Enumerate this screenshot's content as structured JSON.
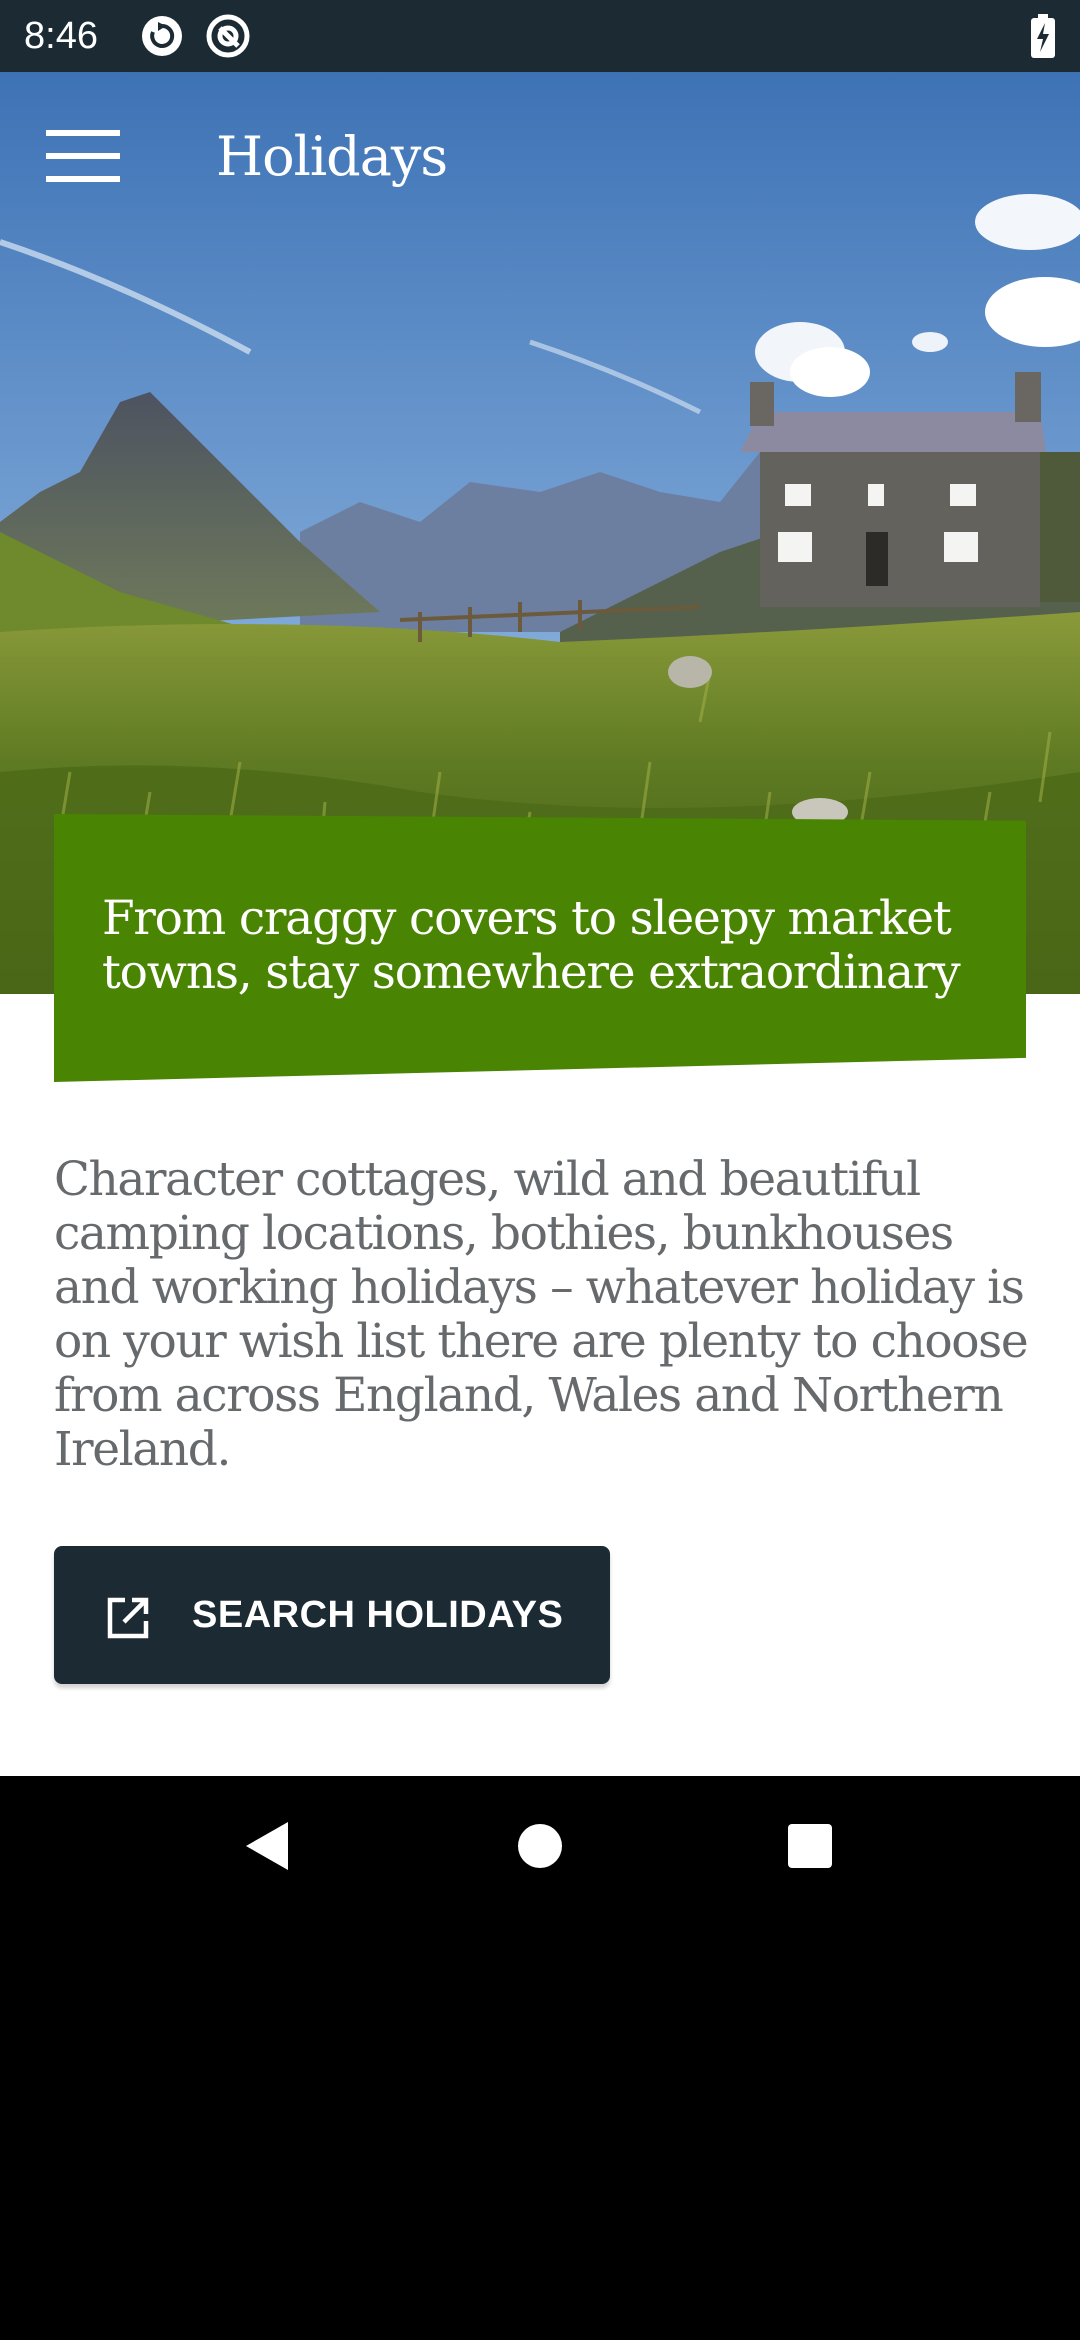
{
  "status_bar": {
    "time": "8:46",
    "icons": [
      "sync-icon",
      "at-sign-icon",
      "battery-charging-icon"
    ]
  },
  "app_bar": {
    "title": "Holidays",
    "menu_icon": "hamburger-menu-icon"
  },
  "hero": {
    "image": "countryside cottage in mountain valley"
  },
  "banner": {
    "headline": "From craggy covers to sleepy market towns, stay somewhere extraordinary"
  },
  "intro": {
    "text": "Character cottages, wild and beautiful camping locations, bothies, bunkhouses and working holidays – whatever holiday is on your wish list there are plenty to choose from across England, Wales and Northern Ireland."
  },
  "cta": {
    "label": "SEARCH HOLIDAYS",
    "icon": "open-in-new-icon"
  },
  "nav_bar": {
    "buttons": [
      "back-icon",
      "home-icon",
      "recents-icon"
    ]
  },
  "colors": {
    "status_bar": "#1b2a33",
    "banner_green": "#4a8403",
    "button_dark": "#1b2a33",
    "body_text_gray": "#666a6d"
  }
}
